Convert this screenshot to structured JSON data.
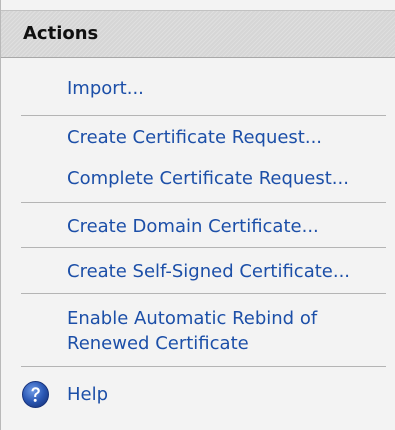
{
  "actions_pane": {
    "title": "Actions",
    "items": [
      {
        "label": "Import..."
      },
      {
        "label": "Create Certificate Request..."
      },
      {
        "label": "Complete Certificate Request..."
      },
      {
        "label": "Create Domain Certificate..."
      },
      {
        "label": "Create Self-Signed Certificate..."
      },
      {
        "label": "Enable Automatic Rebind of Renewed Certificate"
      }
    ],
    "help": {
      "label": "Help",
      "icon": "help-question-icon"
    }
  },
  "colors": {
    "link": "#1c4fa8",
    "header_bg": "#d6d6d6",
    "pane_bg": "#f3f3f3",
    "help_icon": "#2b58b5"
  }
}
